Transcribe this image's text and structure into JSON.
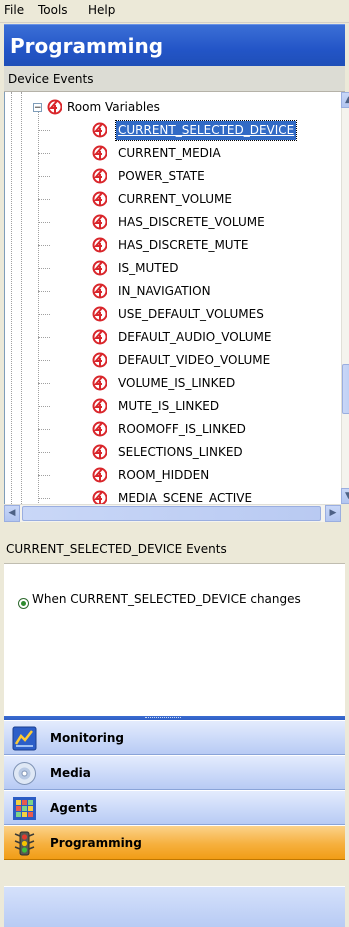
{
  "menu": {
    "items": [
      {
        "label": "File"
      },
      {
        "label": "Tools"
      },
      {
        "label": "Help"
      }
    ]
  },
  "header": {
    "title": "Programming"
  },
  "device_events": {
    "title": "Device Events"
  },
  "tree": {
    "parent": {
      "label": "Room Variables",
      "expanded": true
    },
    "children": [
      {
        "label": "CURRENT_SELECTED_DEVICE",
        "selected": true
      },
      {
        "label": "CURRENT_MEDIA"
      },
      {
        "label": "POWER_STATE"
      },
      {
        "label": "CURRENT_VOLUME"
      },
      {
        "label": "HAS_DISCRETE_VOLUME"
      },
      {
        "label": "HAS_DISCRETE_MUTE"
      },
      {
        "label": "IS_MUTED"
      },
      {
        "label": "IN_NAVIGATION"
      },
      {
        "label": "USE_DEFAULT_VOLUMES"
      },
      {
        "label": "DEFAULT_AUDIO_VOLUME"
      },
      {
        "label": "DEFAULT_VIDEO_VOLUME"
      },
      {
        "label": "VOLUME_IS_LINKED"
      },
      {
        "label": "MUTE_IS_LINKED"
      },
      {
        "label": "ROOMOFF_IS_LINKED"
      },
      {
        "label": "SELECTIONS_LINKED"
      },
      {
        "label": "ROOM_HIDDEN"
      },
      {
        "label": "MEDIA_SCENE_ACTIVE"
      }
    ]
  },
  "events_panel": {
    "title": "CURRENT_SELECTED_DEVICE Events",
    "event_text": "When CURRENT_SELECTED_DEVICE changes"
  },
  "nav": {
    "buttons": [
      {
        "label": "Monitoring",
        "icon": "monitoring-icon"
      },
      {
        "label": "Media",
        "icon": "media-icon"
      },
      {
        "label": "Agents",
        "icon": "agents-icon"
      },
      {
        "label": "Programming",
        "icon": "programming-icon",
        "active": true
      }
    ]
  },
  "colors": {
    "header_blue": "#2355c7",
    "selection_blue": "#316ac5",
    "variable_icon_red": "#d9262b",
    "active_nav_orange": "#f6b03e"
  }
}
